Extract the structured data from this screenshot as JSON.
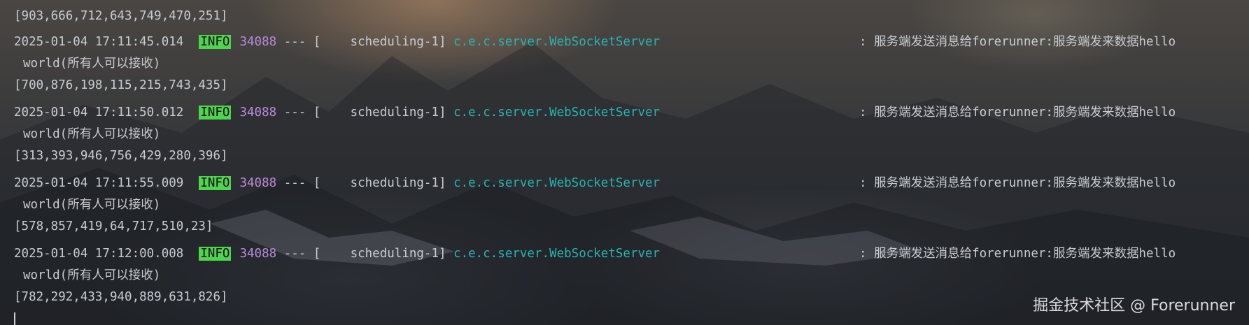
{
  "console": {
    "top_line": "[903,666,712,643,749,470,251]",
    "entries": [
      {
        "timestamp": "2025-01-04 17:11:45.014",
        "level": "INFO",
        "pid": "34088",
        "separator": "--- [",
        "thread": "scheduling-1]",
        "logger": "c.e.c.server.WebSocketServer",
        "message": ": 服务端发送消息给forerunner:服务端发来数据hello",
        "message_cont": "world(所有人可以接收)",
        "array": "[700,876,198,115,215,743,435]"
      },
      {
        "timestamp": "2025-01-04 17:11:50.012",
        "level": "INFO",
        "pid": "34088",
        "separator": "--- [",
        "thread": "scheduling-1]",
        "logger": "c.e.c.server.WebSocketServer",
        "message": ": 服务端发送消息给forerunner:服务端发来数据hello",
        "message_cont": "world(所有人可以接收)",
        "array": "[313,393,946,756,429,280,396]"
      },
      {
        "timestamp": "2025-01-04 17:11:55.009",
        "level": "INFO",
        "pid": "34088",
        "separator": "--- [",
        "thread": "scheduling-1]",
        "logger": "c.e.c.server.WebSocketServer",
        "message": ": 服务端发送消息给forerunner:服务端发来数据hello",
        "message_cont": "world(所有人可以接收)",
        "array": "[578,857,419,64,717,510,23]"
      },
      {
        "timestamp": "2025-01-04 17:12:00.008",
        "level": "INFO",
        "pid": "34088",
        "separator": "--- [",
        "thread": "scheduling-1]",
        "logger": "c.e.c.server.WebSocketServer",
        "message": ": 服务端发送消息给forerunner:服务端发来数据hello",
        "message_cont": "world(所有人可以接收)",
        "array": "[782,292,433,940,889,631,826]"
      }
    ]
  },
  "watermark": "掘金技术社区 @ Forerunner",
  "colors": {
    "level_bg": "#4fd44f",
    "pid": "#b98bd8",
    "logger": "#2ab3ad",
    "text": "#c9ccd2"
  }
}
